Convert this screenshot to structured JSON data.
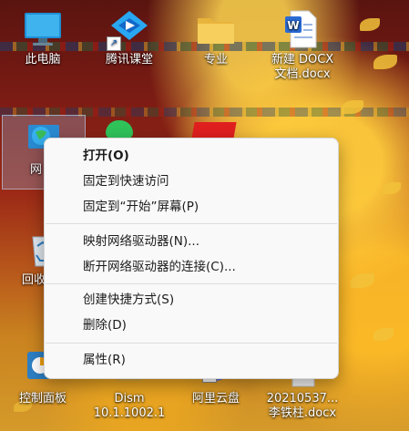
{
  "desktop": {
    "icons": [
      {
        "id": "this-pc",
        "label": "此电脑"
      },
      {
        "id": "tencent-classroom",
        "label": "腾讯课堂"
      },
      {
        "id": "major-folder",
        "label": "专业"
      },
      {
        "id": "new-docx",
        "label_line1": "新建 DOCX",
        "label_line2": "文档.docx"
      },
      {
        "id": "network",
        "label": "网"
      },
      {
        "id": "recycle-bin",
        "label": "回收"
      },
      {
        "id": "control-panel",
        "label": "控制面板"
      },
      {
        "id": "dism",
        "label_line1": "Dism",
        "label_line2": "10.1.1002.1"
      },
      {
        "id": "aliyun-drive",
        "label": "阿里云盘"
      },
      {
        "id": "docx-file",
        "label_line1": "20210537...",
        "label_line2": "李铁柱.docx"
      }
    ]
  },
  "context_menu": {
    "open": "打开(O)",
    "pin_quick_access": "固定到快速访问",
    "pin_start": "固定到“开始”屏幕(P)",
    "map_drive": "映射网络驱动器(N)...",
    "disconnect_drive": "断开网络驱动器的连接(C)...",
    "create_shortcut": "创建快捷方式(S)",
    "delete": "删除(D)",
    "properties": "属性(R)"
  }
}
